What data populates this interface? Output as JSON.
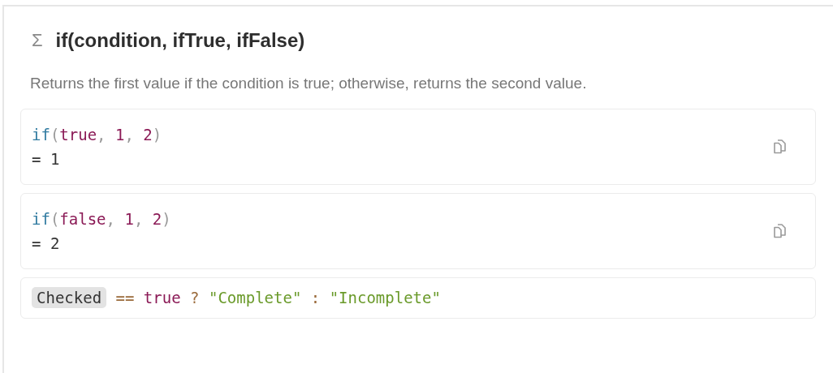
{
  "title": {
    "icon": "Σ",
    "text": "if(condition, ifTrue, ifFalse)"
  },
  "description": "Returns the first value if the condition is true; otherwise, returns the second value.",
  "examples": [
    {
      "kind": "result",
      "copyable": true,
      "tokens": [
        {
          "color": "#2f7aa0",
          "text": "if"
        },
        {
          "color": "#999999",
          "text": "("
        },
        {
          "color": "#8b1a56",
          "text": "true"
        },
        {
          "color": "#999999",
          "text": ", "
        },
        {
          "color": "#8b1a56",
          "text": "1"
        },
        {
          "color": "#999999",
          "text": ", "
        },
        {
          "color": "#8b1a56",
          "text": "2"
        },
        {
          "color": "#999999",
          "text": ")"
        }
      ],
      "result": "= 1"
    },
    {
      "kind": "result",
      "copyable": true,
      "tokens": [
        {
          "color": "#2f7aa0",
          "text": "if"
        },
        {
          "color": "#999999",
          "text": "("
        },
        {
          "color": "#8b1a56",
          "text": "false"
        },
        {
          "color": "#999999",
          "text": ", "
        },
        {
          "color": "#8b1a56",
          "text": "1"
        },
        {
          "color": "#999999",
          "text": ", "
        },
        {
          "color": "#8b1a56",
          "text": "2"
        },
        {
          "color": "#999999",
          "text": ")"
        }
      ],
      "result": "= 2"
    },
    {
      "kind": "expression",
      "copyable": false,
      "property": "Checked",
      "tokens": [
        {
          "color": "#9a6a3a",
          "text": " == "
        },
        {
          "color": "#8b1a56",
          "text": "true"
        },
        {
          "color": "#9a6a3a",
          "text": " ? "
        },
        {
          "color": "#6a9a2a",
          "text": "\"Complete\""
        },
        {
          "color": "#9a6a3a",
          "text": " : "
        },
        {
          "color": "#6a9a2a",
          "text": "\"Incomplete\""
        }
      ]
    }
  ]
}
